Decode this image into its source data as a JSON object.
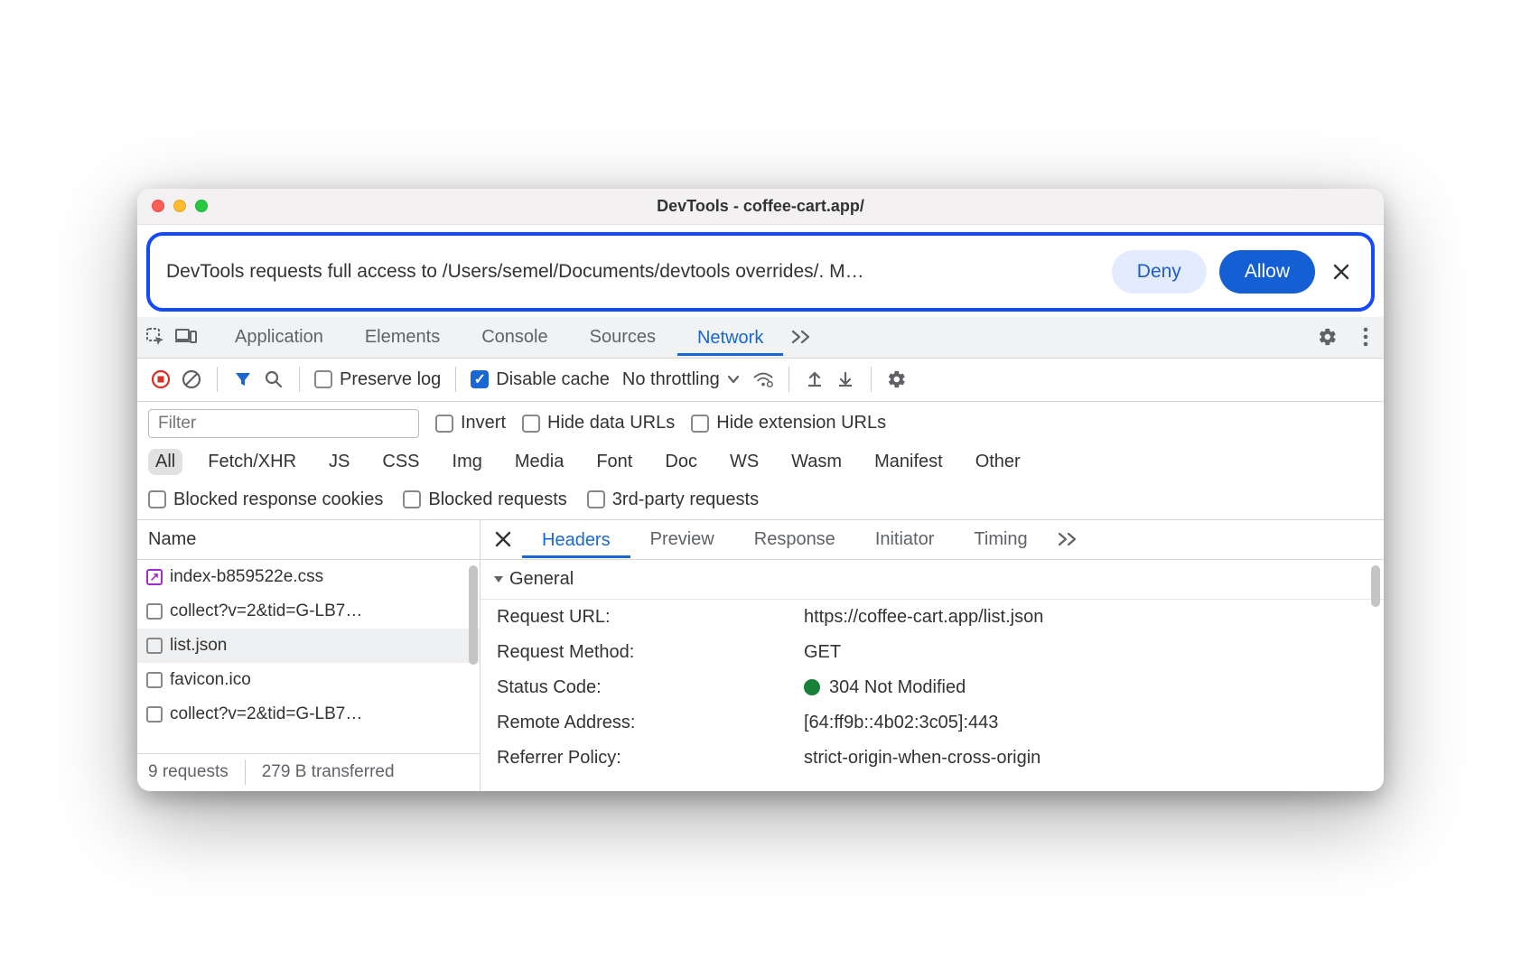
{
  "window": {
    "title": "DevTools - coffee-cart.app/"
  },
  "banner": {
    "text": "DevTools requests full access to /Users/semel/Documents/devtools overrides/. M…",
    "deny": "Deny",
    "allow": "Allow"
  },
  "tabs": {
    "application": "Application",
    "elements": "Elements",
    "console": "Console",
    "sources": "Sources",
    "network": "Network"
  },
  "toolbar": {
    "preserve_log": "Preserve log",
    "disable_cache": "Disable cache",
    "throttling": "No throttling"
  },
  "filter": {
    "placeholder": "Filter",
    "invert": "Invert",
    "hide_data": "Hide data URLs",
    "hide_ext": "Hide extension URLs"
  },
  "types": {
    "all": "All",
    "fetch": "Fetch/XHR",
    "js": "JS",
    "css": "CSS",
    "img": "Img",
    "media": "Media",
    "font": "Font",
    "doc": "Doc",
    "ws": "WS",
    "wasm": "Wasm",
    "manifest": "Manifest",
    "other": "Other"
  },
  "extra": {
    "blocked_cookies": "Blocked response cookies",
    "blocked_requests": "Blocked requests",
    "third_party": "3rd-party requests"
  },
  "name_header": "Name",
  "requests": [
    {
      "name": "index-b859522e.css",
      "override": true
    },
    {
      "name": "collect?v=2&tid=G-LB7…",
      "override": false
    },
    {
      "name": "list.json",
      "override": false,
      "selected": true
    },
    {
      "name": "favicon.ico",
      "override": false
    },
    {
      "name": "collect?v=2&tid=G-LB7…",
      "override": false
    }
  ],
  "footer": {
    "requests": "9 requests",
    "transferred": "279 B transferred"
  },
  "detail_tabs": {
    "headers": "Headers",
    "preview": "Preview",
    "response": "Response",
    "initiator": "Initiator",
    "timing": "Timing"
  },
  "general": {
    "label": "General",
    "request_url_key": "Request URL:",
    "request_url_val": "https://coffee-cart.app/list.json",
    "method_key": "Request Method:",
    "method_val": "GET",
    "status_key": "Status Code:",
    "status_val": "304 Not Modified",
    "remote_key": "Remote Address:",
    "remote_val": "[64:ff9b::4b02:3c05]:443",
    "referrer_key": "Referrer Policy:",
    "referrer_val": "strict-origin-when-cross-origin"
  }
}
